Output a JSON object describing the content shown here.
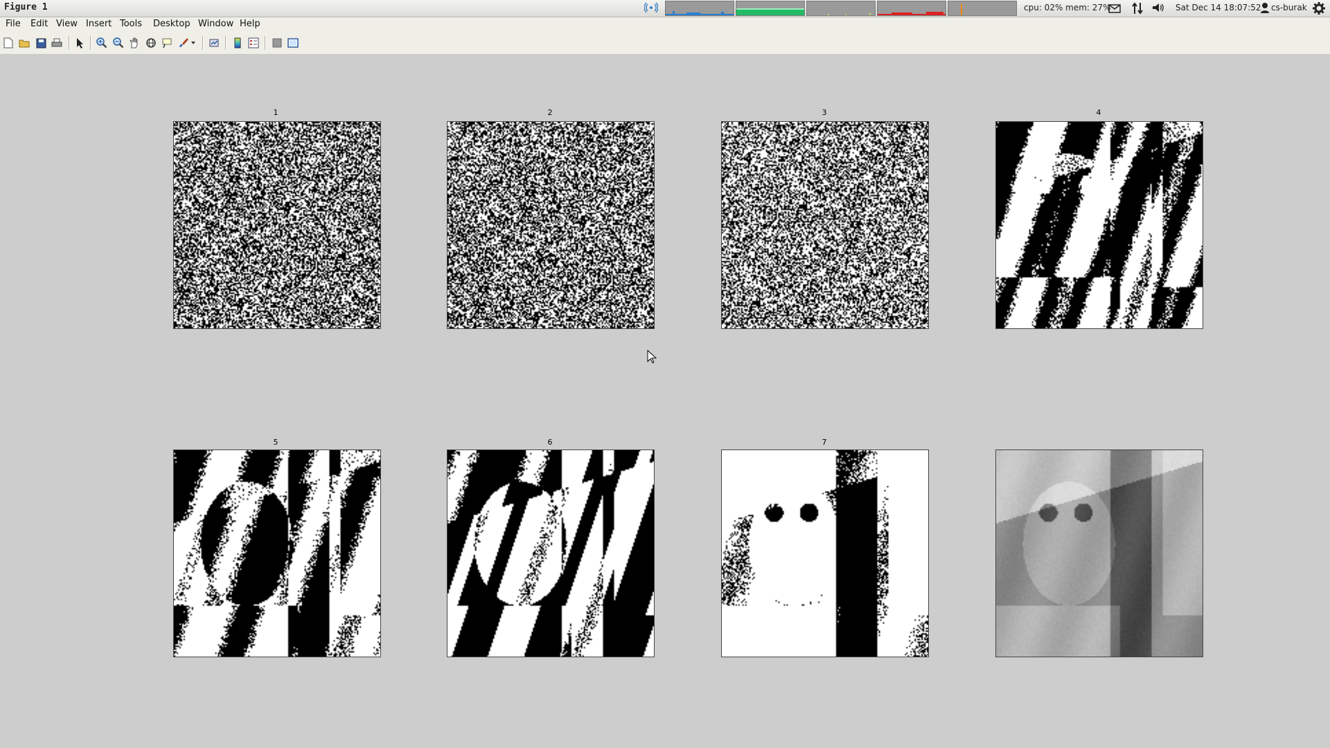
{
  "window": {
    "title": "Figure 1"
  },
  "panel_status": {
    "cpu_mem": "cpu: 02% mem: 27%",
    "datetime": "Sat Dec 14 18:07:52",
    "user": "cs-burak",
    "graph_colors": [
      "#2a7fd0",
      "#22bb66",
      "#dddd66",
      "#dd2222",
      "#ee8800"
    ]
  },
  "menu": {
    "file": "File",
    "edit": "Edit",
    "view": "View",
    "insert": "Insert",
    "tools": "Tools",
    "desktop": "Desktop",
    "window": "Window",
    "help": "Help"
  },
  "toolbar_icons": [
    "new-figure-icon",
    "open-file-icon",
    "save-icon",
    "print-icon",
    "edit-plot-arrow-icon",
    "zoom-in-icon",
    "zoom-out-icon",
    "pan-hand-icon",
    "rotate-3d-icon",
    "data-cursor-icon",
    "brush-icon",
    "brush-dropdown-icon",
    "link-plot-icon",
    "insert-colorbar-icon",
    "insert-legend-icon",
    "hide-plot-tools-icon",
    "show-plot-tools-icon"
  ],
  "subplots": [
    {
      "title": "1",
      "style": "noise",
      "density": 0.5
    },
    {
      "title": "2",
      "style": "noise",
      "density": 0.5
    },
    {
      "title": "3",
      "style": "noise",
      "density": 0.45
    },
    {
      "title": "4",
      "style": "bands",
      "density": 0.45
    },
    {
      "title": "5",
      "style": "bands",
      "density": 0.45
    },
    {
      "title": "6",
      "style": "portrait-binary",
      "density": 0.5
    },
    {
      "title": "7",
      "style": "portrait-binary",
      "density": 0.4
    },
    {
      "title": "",
      "style": "portrait-gray",
      "density": 0
    }
  ]
}
